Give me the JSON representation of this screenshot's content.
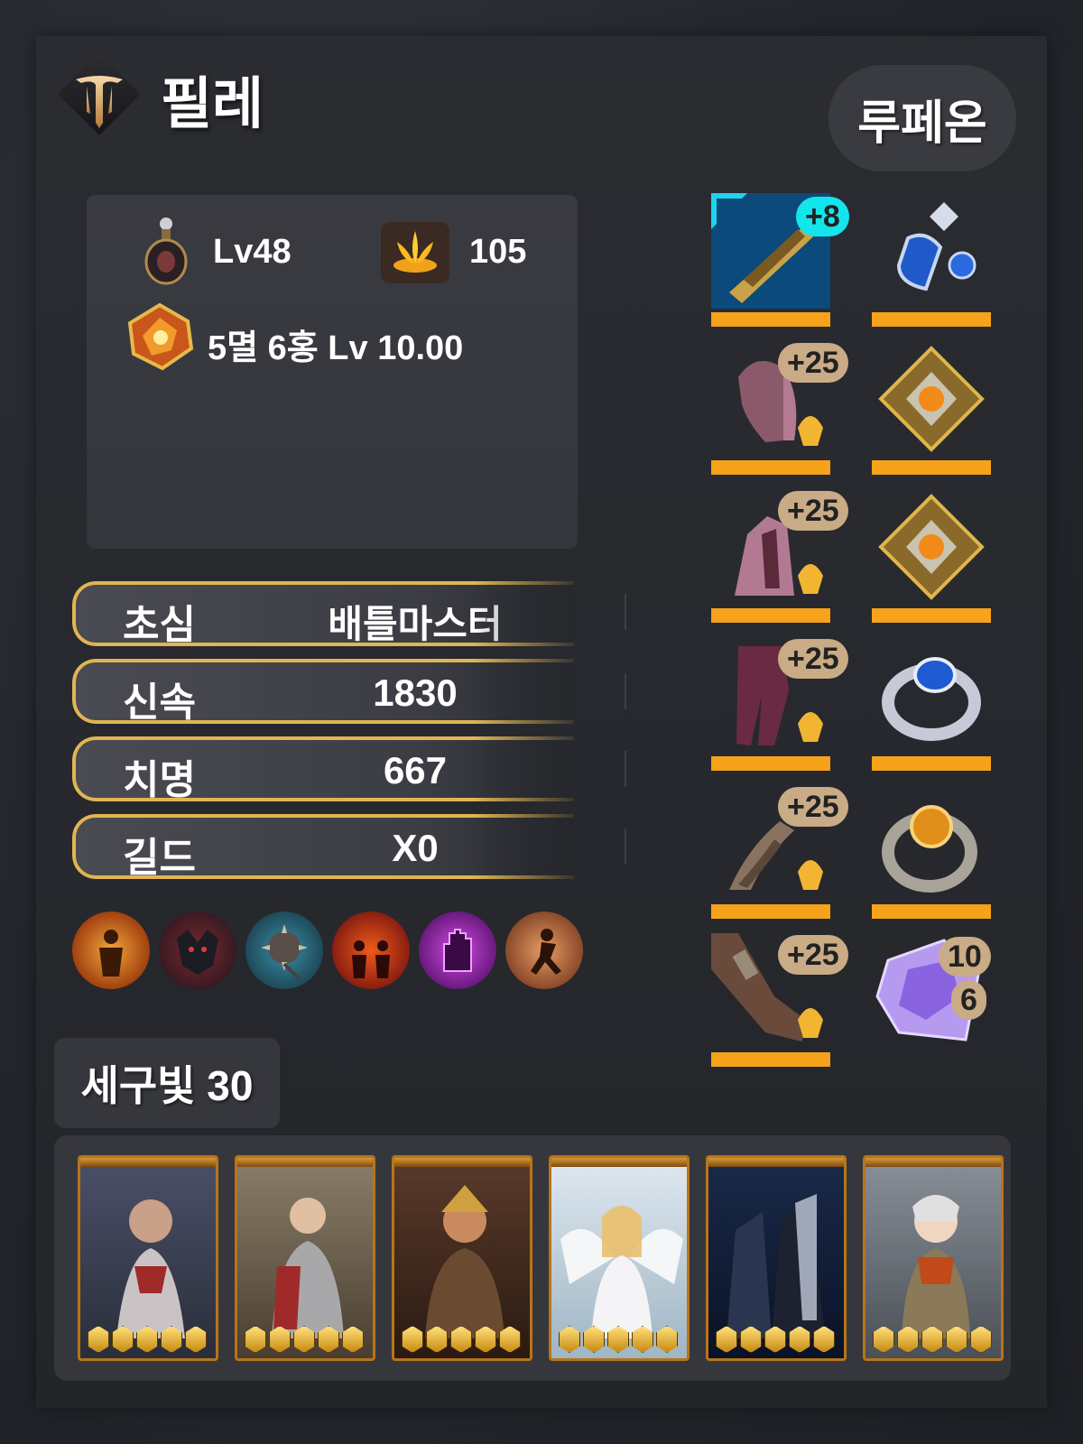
{
  "header": {
    "character_name": "필레",
    "server_name": "루페온"
  },
  "info": {
    "level_label": "Lv48",
    "bloom_value": "105",
    "gem_summary": "5멸 6홍 Lv 10.00"
  },
  "stats": [
    {
      "label": "초심",
      "value": "배틀마스터"
    },
    {
      "label": "신속",
      "value": "1830"
    },
    {
      "label": "치명",
      "value": "667"
    },
    {
      "label": "길드",
      "value": "X0"
    }
  ],
  "engravings": [
    {
      "icon": "engraving-glow-figure-icon",
      "color": "#c76a10"
    },
    {
      "icon": "engraving-beast-icon",
      "color": "#9e2a2a"
    },
    {
      "icon": "engraving-spiked-ball-icon",
      "color": "#2d7f95"
    },
    {
      "icon": "engraving-flame-crowd-icon",
      "color": "#b3391b"
    },
    {
      "icon": "engraving-purple-hand-icon",
      "color": "#9a2fb0"
    },
    {
      "icon": "engraving-leaping-figure-icon",
      "color": "#a8582a"
    }
  ],
  "gem_label": "세구빛 30",
  "equipment": {
    "left": [
      {
        "icon": "gold-weapon-icon",
        "badge": "+8",
        "badge_style": "cyan"
      },
      {
        "icon": "helmet-icon",
        "badge": "+25",
        "badge_style": "tan"
      },
      {
        "icon": "chest-armor-icon",
        "badge": "+25",
        "badge_style": "tan"
      },
      {
        "icon": "pants-icon",
        "badge": "+25",
        "badge_style": "tan"
      },
      {
        "icon": "shoulder-icon",
        "badge": "+25",
        "badge_style": "tan"
      },
      {
        "icon": "gloves-icon",
        "badge": "+25",
        "badge_style": "tan"
      }
    ],
    "right": [
      {
        "icon": "sapphire-earring-icon"
      },
      {
        "icon": "gold-necklace-icon"
      },
      {
        "icon": "gold-necklace-icon"
      },
      {
        "icon": "sapphire-ring-icon"
      },
      {
        "icon": "amber-ring-icon"
      },
      {
        "icon": "purple-crystal-icon",
        "badge_top": "10",
        "badge_bottom": "6"
      }
    ]
  },
  "collection_cards": [
    {
      "name": "card-1",
      "bg": "#3a3f55",
      "stars": 5
    },
    {
      "name": "card-2",
      "bg": "#6a5d4e",
      "stars": 5
    },
    {
      "name": "card-3",
      "bg": "#4e3328",
      "stars": 5
    },
    {
      "name": "card-4",
      "bg": "#9fb6c4",
      "stars": 5
    },
    {
      "name": "card-5",
      "bg": "#1c2a45",
      "stars": 5
    },
    {
      "name": "card-6",
      "bg": "#5b6267",
      "stars": 5
    }
  ],
  "colors": {
    "stat_border": "#e0b552",
    "equip_bar": "#f6a21b",
    "badge_tan": "#c9ab86",
    "badge_cyan": "#12e6ec"
  }
}
